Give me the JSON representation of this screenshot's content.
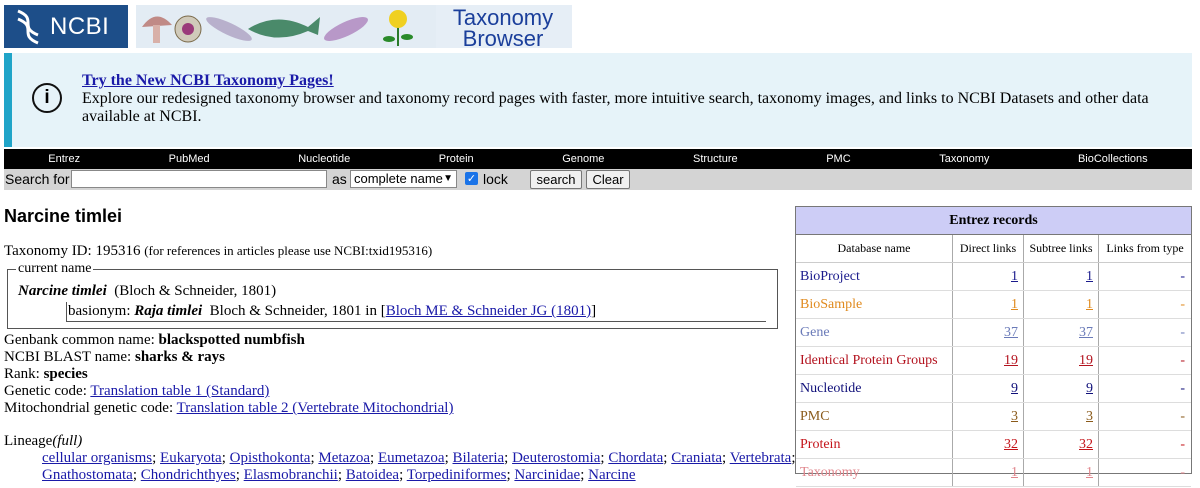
{
  "header": {
    "logo_text": "NCBI",
    "banner_title_line1": "Taxonomy",
    "banner_title_line2": "Browser"
  },
  "info": {
    "title": "Try the New NCBI Taxonomy Pages!",
    "text": "Explore our redesigned taxonomy browser and taxonomy record pages with faster, more intuitive search, taxonomy images, and links to NCBI Datasets and other data available at NCBI."
  },
  "nav": [
    "Entrez",
    "PubMed",
    "Nucleotide",
    "Protein",
    "Genome",
    "Structure",
    "PMC",
    "Taxonomy",
    "BioCollections"
  ],
  "search": {
    "label": "Search for",
    "value": "",
    "as_label": "as",
    "mode_selected": "complete name",
    "lock_label": "lock",
    "lock_checked": true,
    "search_button": "search",
    "clear_button": "Clear"
  },
  "record": {
    "title": "Narcine timlei",
    "taxonomy_id_label": "Taxonomy ID:",
    "taxonomy_id": "195316",
    "taxonomy_id_note": "(for references in articles please use NCBI:txid195316)",
    "current_name_legend": "current name",
    "current_name": "Narcine timlei",
    "current_authority": "(Bloch & Schneider, 1801)",
    "basionym_label": "basionym:",
    "basionym_name": "Raja timlei",
    "basionym_authority": "Bloch & Schneider, 1801 in [",
    "basionym_ref": "Bloch ME & Schneider JG (1801)",
    "basionym_close": "]",
    "genbank_label": "Genbank common name:",
    "genbank_value": "blackspotted numbfish",
    "blast_label": "NCBI BLAST name:",
    "blast_value": "sharks & rays",
    "rank_label": "Rank:",
    "rank_value": "species",
    "genetic_label": "Genetic code:",
    "genetic_value": "Translation table 1 (Standard)",
    "mito_label": "Mitochondrial genetic code:",
    "mito_value": "Translation table 2 (Vertebrate Mitochondrial)",
    "lineage_label": "Lineage",
    "lineage_full": "(full)",
    "lineage": [
      "cellular organisms",
      "Eukaryota",
      "Opisthokonta",
      "Metazoa",
      "Eumetazoa",
      "Bilateria",
      "Deuterostomia",
      "Chordata",
      "Craniata",
      "Vertebrata",
      "Gnathostomata",
      "Chondrichthyes",
      "Elasmobranchii",
      "Batoidea",
      "Torpediniformes",
      "Narcinidae",
      "Narcine"
    ]
  },
  "entrez": {
    "title": "Entrez records",
    "columns": [
      "Database name",
      "Direct links",
      "Subtree links",
      "Links from type"
    ],
    "rows": [
      {
        "name": "BioProject",
        "direct": "1",
        "subtree": "1",
        "from_type": "-",
        "color": "#1a1a8c"
      },
      {
        "name": "BioSample",
        "direct": "1",
        "subtree": "1",
        "from_type": "-",
        "color": "#e08a1e"
      },
      {
        "name": "Gene",
        "direct": "37",
        "subtree": "37",
        "from_type": "-",
        "color": "#6a7ab8"
      },
      {
        "name": "Identical Protein Groups",
        "direct": "19",
        "subtree": "19",
        "from_type": "-",
        "color": "#b3121e"
      },
      {
        "name": "Nucleotide",
        "direct": "9",
        "subtree": "9",
        "from_type": "-",
        "color": "#10107a"
      },
      {
        "name": "PMC",
        "direct": "3",
        "subtree": "3",
        "from_type": "-",
        "color": "#8a5a1a"
      },
      {
        "name": "Protein",
        "direct": "32",
        "subtree": "32",
        "from_type": "-",
        "color": "#c4141a"
      },
      {
        "name": "Taxonomy",
        "direct": "1",
        "subtree": "1",
        "from_type": "-",
        "color": "#e0858c"
      }
    ]
  }
}
